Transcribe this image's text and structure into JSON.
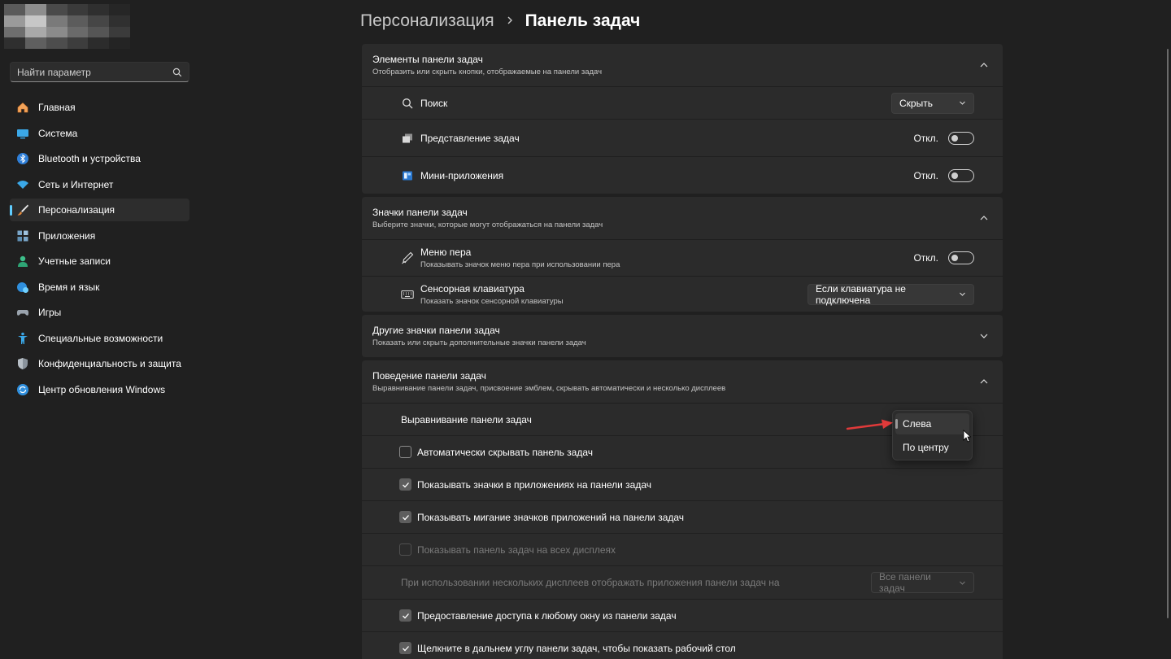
{
  "sidebar": {
    "search_placeholder": "Найти параметр",
    "items": [
      {
        "label": "Главная",
        "icon": "home-icon",
        "active": false
      },
      {
        "label": "Система",
        "icon": "monitor-icon",
        "active": false
      },
      {
        "label": "Bluetooth и устройства",
        "icon": "bluetooth-icon",
        "active": false
      },
      {
        "label": "Сеть и Интернет",
        "icon": "wifi-icon",
        "active": false
      },
      {
        "label": "Персонализация",
        "icon": "brush-icon",
        "active": true
      },
      {
        "label": "Приложения",
        "icon": "apps-icon",
        "active": false
      },
      {
        "label": "Учетные записи",
        "icon": "person-icon",
        "active": false
      },
      {
        "label": "Время и язык",
        "icon": "globe-clock-icon",
        "active": false
      },
      {
        "label": "Игры",
        "icon": "gamepad-icon",
        "active": false
      },
      {
        "label": "Специальные возможности",
        "icon": "accessibility-icon",
        "active": false
      },
      {
        "label": "Конфиденциальность и защита",
        "icon": "shield-icon",
        "active": false
      },
      {
        "label": "Центр обновления Windows",
        "icon": "update-icon",
        "active": false
      }
    ]
  },
  "header": {
    "parent": "Персонализация",
    "current": "Панель задач"
  },
  "sections": {
    "elements": {
      "title": "Элементы панели задач",
      "sub": "Отобразить или скрыть кнопки, отображаемые на панели задач",
      "search": {
        "label": "Поиск",
        "value": "Скрыть"
      },
      "task_view": {
        "label": "Представление задач",
        "state": "Откл."
      },
      "widgets": {
        "label": "Мини-приложения",
        "state": "Откл."
      }
    },
    "icons": {
      "title": "Значки панели задач",
      "sub": "Выберите значки, которые могут отображаться на панели задач",
      "pen": {
        "label": "Меню пера",
        "sub": "Показывать значок меню пера при использовании пера",
        "state": "Откл."
      },
      "keyboard": {
        "label": "Сенсорная клавиатура",
        "sub": "Показать значок сенсорной клавиатуры",
        "value": "Если клавиатура не подключена"
      }
    },
    "other": {
      "title": "Другие значки панели задач",
      "sub": "Показать или скрыть дополнительные значки панели задач"
    },
    "behavior": {
      "title": "Поведение панели задач",
      "sub": "Выравнивание панели задач, присвоение эмблем, скрывать автоматически и несколько дисплеев",
      "alignment": {
        "label": "Выравнивание панели задач"
      },
      "autohide": {
        "label": "Автоматически скрывать панель задач",
        "checked": false
      },
      "badges": {
        "label": "Показывать значки в приложениях на панели задач",
        "checked": true
      },
      "flashing": {
        "label": "Показывать мигание значков приложений на панели задач",
        "checked": true
      },
      "all_displays": {
        "label": "Показывать панель задач на всех дисплеях",
        "checked": false,
        "disabled": true
      },
      "multi_display": {
        "label": "При использовании нескольких дисплеев отображать приложения панели задач на",
        "value": "Все панели задач",
        "disabled": true
      },
      "share_window": {
        "label": "Предоставление доступа к любому окну из панели задач",
        "checked": true
      },
      "far_corner": {
        "label": "Щелкните в дальнем углу панели задач, чтобы показать рабочий стол",
        "checked": true
      }
    }
  },
  "alignment_popup": {
    "options": [
      "Слева",
      "По центру"
    ],
    "selected": "Слева"
  },
  "colors": {
    "background": "#202020",
    "card": "#2b2b2b",
    "accent": "#60cdff",
    "annotation_arrow": "#e03a3a"
  }
}
